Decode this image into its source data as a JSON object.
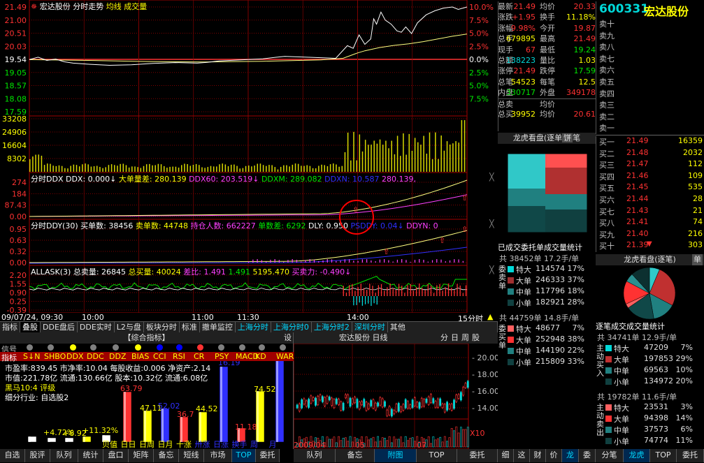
{
  "stock": {
    "name": "宏达股份",
    "code": "600331",
    "chart_title": "分时走势",
    "avg_label": "均线",
    "vol_label": "成交量"
  },
  "chart_data": [
    {
      "type": "line",
      "title": "宏达股份 分时走势",
      "y_ticks_left": [
        "21.49",
        "21.00",
        "20.51",
        "20.03",
        "19.54",
        "19.05",
        "18.57",
        "18.08",
        "17.59"
      ],
      "y_ticks_right": [
        "10.0%",
        "7.5%",
        "5.0%",
        "2.5%",
        "0.0%",
        "2.5%",
        "5.0%",
        "7.5%"
      ],
      "ylim": [
        17.59,
        21.49
      ],
      "prev_close": 19.54,
      "x_ticks": [
        "09/07/24, 09:30",
        "10:00",
        "11:00",
        "11:30",
        "14:00",
        "15:00"
      ],
      "series": [
        {
          "name": "价格",
          "points": [
            [
              0,
              19.53
            ],
            [
              6,
              19.62
            ],
            [
              12,
              19.5
            ],
            [
              18,
              19.55
            ],
            [
              24,
              19.45
            ],
            [
              30,
              19.4
            ],
            [
              40,
              19.36
            ],
            [
              55,
              19.32
            ],
            [
              70,
              19.34
            ],
            [
              85,
              19.39
            ],
            [
              100,
              19.42
            ],
            [
              115,
              19.4
            ],
            [
              122,
              19.43
            ],
            [
              130,
              19.48
            ],
            [
              145,
              19.52
            ],
            [
              160,
              19.56
            ],
            [
              168,
              19.61
            ],
            [
              175,
              19.65
            ],
            [
              185,
              19.63
            ],
            [
              195,
              19.61
            ],
            [
              210,
              19.58
            ],
            [
              218,
              20.05
            ],
            [
              222,
              19.95
            ],
            [
              226,
              20.45
            ],
            [
              230,
              20.1
            ],
            [
              234,
              20.3
            ],
            [
              236,
              21.05
            ],
            [
              238,
              20.85
            ],
            [
              241,
              21.3
            ],
            [
              244,
              21.0
            ],
            [
              248,
              20.85
            ],
            [
              252,
              20.6
            ],
            [
              255,
              20.55
            ],
            [
              258,
              20.75
            ],
            [
              262,
              20.5
            ],
            [
              266,
              20.9
            ],
            [
              272,
              21.2
            ],
            [
              278,
              21.35
            ],
            [
              284,
              21.45
            ],
            [
              290,
              21.49
            ],
            [
              294,
              21.4
            ],
            [
              300,
              21.49
            ]
          ]
        },
        {
          "name": "均线",
          "points": [
            [
              0,
              19.53
            ],
            [
              40,
              19.5
            ],
            [
              80,
              19.46
            ],
            [
              120,
              19.44
            ],
            [
              160,
              19.47
            ],
            [
              200,
              19.52
            ],
            [
              215,
              19.58
            ],
            [
              220,
              19.68
            ],
            [
              225,
              19.78
            ],
            [
              230,
              19.86
            ],
            [
              240,
              19.98
            ],
            [
              250,
              20.06
            ],
            [
              260,
              20.12
            ],
            [
              270,
              20.2
            ],
            [
              280,
              20.3
            ],
            [
              290,
              20.4
            ],
            [
              300,
              20.48
            ]
          ]
        }
      ],
      "volume": {
        "y_ticks": [
          "33208",
          "24906",
          "16604",
          "8302"
        ],
        "max": 41510
      }
    },
    {
      "type": "line",
      "title": "分时DDX",
      "y_ticks": [
        "274",
        "184",
        "87.43",
        "0.00"
      ],
      "label": "DDX",
      "value": "0.000",
      "labels": [
        [
          "DDX: 0.000↓",
          "#ffffff"
        ],
        [
          "大单量差: 280.139",
          "#ffff00"
        ],
        [
          "DDX60: 203.519↓",
          "#ff40ff"
        ],
        [
          "DDXM: 289.082",
          "#00e600"
        ],
        [
          "DDXN: 10.587",
          "#3030ff"
        ],
        [
          "280.139,",
          "#ff40ff"
        ]
      ]
    },
    {
      "type": "line",
      "title": "分时DDY(30)",
      "y_ticks": [
        "0.95",
        "0.63",
        "0.32",
        "0.00"
      ],
      "labels": [
        [
          "买单数: 38456",
          "#ffffff"
        ],
        [
          "卖单数: 44748",
          "#ffff00"
        ],
        [
          "持仓人数: 662227",
          "#ff40ff"
        ],
        [
          "单数差: 6292",
          "#00e600"
        ],
        [
          "DLY: 0.950",
          "#ffffff"
        ],
        [
          "PSDDY: 0.04↓",
          "#3030ff"
        ],
        [
          "DDYN: 0",
          "#ff40ff"
        ]
      ]
    },
    {
      "type": "bar",
      "title": "ALLASK(3)",
      "y_ticks": [
        "2.20",
        "1.55",
        "0.90",
        "0.25",
        "-0.39"
      ],
      "labels": [
        [
          "总卖量: 26845",
          "#ffffff"
        ],
        [
          "总买量: 40024",
          "#ffff00"
        ],
        [
          "差比: 1.491",
          "#ff40ff"
        ],
        [
          "1.491",
          "#00e600"
        ],
        [
          "5195.470",
          "#ffff00"
        ],
        [
          "买卖力: -0.490↓",
          "#ff40ff"
        ]
      ]
    },
    {
      "type": "pie",
      "title": "龙虎看盘(逐笔)",
      "slices": [
        {
          "name": "特大",
          "value": 7
        },
        {
          "name": "大单",
          "value": 29
        },
        {
          "name": "中单",
          "value": 16
        },
        {
          "name": "小单",
          "value": 20
        },
        {
          "name": "特大卖",
          "value": 3
        },
        {
          "name": "大单卖",
          "value": 16
        },
        {
          "name": "中单卖",
          "value": 6
        },
        {
          "name": "小单卖",
          "value": 13
        }
      ]
    },
    {
      "type": "bar",
      "title": "综合指标",
      "categories": [
        "S↓N",
        "SHBO",
        "DDX",
        "DDC",
        "DDZ",
        "BIAS",
        "CCI",
        "RSI",
        "CR",
        "PSY",
        "MACD",
        "KD",
        "WAR"
      ],
      "value_labels": [
        "63.79",
        "47.11",
        "52.02",
        "36.7",
        "44.52",
        "16.19",
        "11.18",
        "74.52",
        "+4.72%",
        "+8.92",
        "+11.32%"
      ]
    }
  ],
  "quote": {
    "rows": [
      {
        "l1": "最新",
        "v1": "21.49",
        "c1": "#ff3232",
        "l2": "均价",
        "v2": "20.33",
        "c2": "#ff3232"
      },
      {
        "l1": "涨跌",
        "v1": "+1.95",
        "c1": "#ff3232",
        "l2": "换手",
        "v2": "11.18%",
        "c2": "#ffff00"
      },
      {
        "l1": "涨幅",
        "v1": "9.98%",
        "c1": "#ff3232",
        "l2": "今开",
        "v2": "19.87",
        "c2": "#ff3232"
      },
      {
        "l1": "总手",
        "v1": "679895",
        "c1": "#ffff00",
        "l2": "最高",
        "v2": "21.49",
        "c2": "#ff3232"
      },
      {
        "l1": "现手",
        "v1": "67",
        "c1": "#ff3232",
        "l2": "最低",
        "v2": "19.24",
        "c2": "#00e600"
      },
      {
        "l1": "总额",
        "v1": "138223",
        "c1": "#00d8d8",
        "l2": "量比",
        "v2": "1.03",
        "c2": "#ffff00"
      },
      {
        "l1": "涨停",
        "v1": "21.49",
        "c1": "#ff3232",
        "l2": "跌停",
        "v2": "17.59",
        "c2": "#00e600"
      },
      {
        "l1": "总笔",
        "v1": "54523",
        "c1": "#ffff00",
        "l2": "每笔",
        "v2": "12.5",
        "c2": "#ffff00"
      },
      {
        "l1": "内盘",
        "v1": "330717",
        "c1": "#00e600",
        "l2": "外盘",
        "v2": "349178",
        "c2": "#ff3232"
      },
      {
        "l1": "总卖",
        "v1": "",
        "c1": "#fff",
        "l2": "均价",
        "v2": "",
        "c2": "#fff"
      },
      {
        "l1": "总买",
        "v1": "39952",
        "c1": "#ffff00",
        "l2": "均价",
        "v2": "20.61",
        "c2": "#ff3232"
      }
    ]
  },
  "sell_book": [
    "卖十",
    "卖九",
    "卖八",
    "卖七",
    "卖六",
    "卖五",
    "卖四",
    "卖三",
    "卖二",
    "卖一"
  ],
  "buy_book": [
    {
      "l": "买一",
      "p": "21.49",
      "v": "16359"
    },
    {
      "l": "买二",
      "p": "21.48",
      "v": "2032"
    },
    {
      "l": "买三",
      "p": "21.47",
      "v": "112"
    },
    {
      "l": "买四",
      "p": "21.46",
      "v": "109"
    },
    {
      "l": "买五",
      "p": "21.45",
      "v": "535"
    },
    {
      "l": "买六",
      "p": "21.44",
      "v": "28"
    },
    {
      "l": "买七",
      "p": "21.43",
      "v": "21"
    },
    {
      "l": "买八",
      "p": "21.41",
      "v": "74"
    },
    {
      "l": "买九",
      "p": "21.40",
      "v": "216"
    },
    {
      "l": "买十",
      "p": "21.39",
      "v": "303"
    }
  ],
  "longhu": {
    "title": "龙虎看盘(逐单",
    "pie_label": "饼",
    "stroke_label": "笔",
    "title2": "龙虎看盘(逐笔)",
    "unit_label": "单",
    "commission_title": "已成交委托单成交量统计",
    "stroke_stats_title": "逐笔成交成交量统计"
  },
  "sell_orders": {
    "header": "共 38452单 17.2手/单",
    "side": "委卖单",
    "rows": [
      {
        "n": "特大",
        "v": "114574",
        "p": "17%",
        "c": "#00d8d8"
      },
      {
        "n": "大单",
        "v": "246333",
        "p": "37%",
        "c": "#a03030"
      },
      {
        "n": "中单",
        "v": "117796",
        "p": "18%",
        "c": "#208080"
      },
      {
        "n": "小单",
        "v": "182921",
        "p": "28%",
        "c": "#104040"
      }
    ]
  },
  "buy_orders": {
    "header": "共 44759单 14.8手/单",
    "side": "委买单",
    "rows": [
      {
        "n": "特大",
        "v": "48677",
        "p": "7%",
        "c": "#ff6060"
      },
      {
        "n": "大单",
        "v": "252948",
        "p": "38%",
        "c": "#ff3232"
      },
      {
        "n": "中单",
        "v": "144190",
        "p": "22%",
        "c": "#208080"
      },
      {
        "n": "小单",
        "v": "215809",
        "p": "33%",
        "c": "#104040"
      }
    ]
  },
  "active_buy": {
    "header": "共 34741单 12.9手/单",
    "side": "主动买入",
    "rows": [
      {
        "n": "特大",
        "v": "47209",
        "p": "7%",
        "c": "#00d8d8"
      },
      {
        "n": "大单",
        "v": "197853",
        "p": "29%",
        "c": "#c03030"
      },
      {
        "n": "中单",
        "v": "69563",
        "p": "10%",
        "c": "#208080"
      },
      {
        "n": "小单",
        "v": "134972",
        "p": "20%",
        "c": "#104040"
      }
    ]
  },
  "active_sell": {
    "header": "共 19782单 11.6手/单",
    "side": "主动卖出",
    "rows": [
      {
        "n": "特大",
        "v": "23531",
        "p": "3%",
        "c": "#ff6060"
      },
      {
        "n": "大单",
        "v": "94398",
        "p": "14%",
        "c": "#ff3232"
      },
      {
        "n": "中单",
        "v": "37573",
        "p": "6%",
        "c": "#208080"
      },
      {
        "n": "小单",
        "v": "74774",
        "p": "11%",
        "c": "#104040"
      }
    ]
  },
  "tabs": [
    "指标",
    "叠股",
    "DDE盘后",
    "DDE实时",
    "L2与盘",
    "板块分时",
    "标准",
    "撤单监控",
    "上海分时",
    "上海分时0",
    "上海分时2",
    "深圳分时",
    "其他"
  ],
  "composite": {
    "title": "【综合指标】",
    "set": "设",
    "signal_label": "信号",
    "indicator_label": "指标",
    "line1": "市盈率:839.45 市净率:10.04 每股收益:0.006 净资产:2.14",
    "line2": "市值:221.78亿 流通:130.66亿 股本:10.32亿 流通:6.08亿",
    "line3": "黑马10:4 评级",
    "line4": "细分行业: 自选股2",
    "bottom_labels": [
      "贝值",
      "日日",
      "日周",
      "日月",
      "十涨",
      "卅涨",
      "日涨",
      "换手",
      "周",
      "月"
    ]
  },
  "daily": {
    "title": "宏达股份 日线",
    "tabs": [
      "分",
      "日",
      "周",
      "股"
    ],
    "y_ticks": [
      "20.00",
      "18.00",
      "16.00",
      "14.00"
    ],
    "x_ticks": [
      "2009/04",
      "05",
      "07"
    ],
    "vol_tag": "X10"
  },
  "bottom_left": [
    "自选",
    "股评",
    "队列",
    "统计",
    "盘口",
    "矩阵",
    "备忘",
    "短线",
    "市场",
    "TOP",
    "委托"
  ],
  "bottom_mid": [
    "队列",
    "备忘",
    "附图",
    "TOP",
    "委托"
  ],
  "bottom_right1": [
    "细",
    "这",
    "财",
    "价",
    "龙",
    "委"
  ],
  "bottom_right2": [
    "分笔",
    "龙虎",
    "TOP",
    "委托"
  ],
  "time_label": "15分时"
}
